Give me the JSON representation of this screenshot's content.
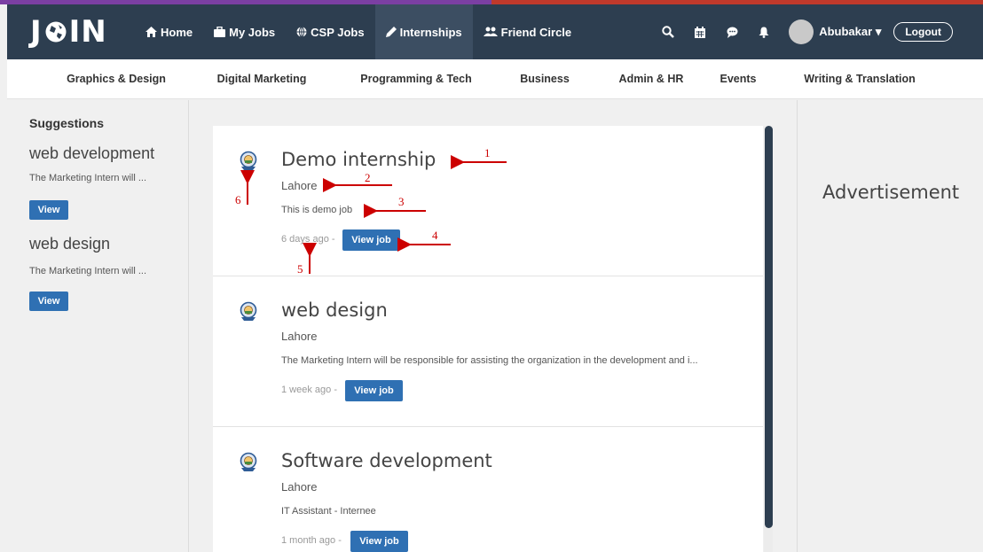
{
  "topnav": {
    "logo": {
      "j": "J",
      "in": "IN"
    },
    "links": [
      {
        "label": "Home",
        "icon": "home-icon"
      },
      {
        "label": "My Jobs",
        "icon": "briefcase-icon"
      },
      {
        "label": "CSP Jobs",
        "icon": "globe-icon"
      },
      {
        "label": "Internships",
        "icon": "pencil-icon",
        "active": true
      },
      {
        "label": "Friend Circle",
        "icon": "users-icon"
      }
    ],
    "right_icons": [
      "search-icon",
      "calendar-icon",
      "chat-icon",
      "bell-icon"
    ],
    "user_name": "Abubakar",
    "logout_label": "Logout"
  },
  "categories": [
    "Graphics & Design",
    "Digital Marketing",
    "Programming & Tech",
    "Business",
    "Admin & HR",
    "Events",
    "Writing & Translation"
  ],
  "sidebar": {
    "heading": "Suggestions",
    "items": [
      {
        "title": "web development",
        "desc": "The Marketing Intern will ...",
        "button": "View"
      },
      {
        "title": "web design",
        "desc": "The Marketing Intern will ...",
        "button": "View"
      }
    ]
  },
  "jobs": [
    {
      "title": "Demo internship",
      "location": "Lahore",
      "description": "This is demo job",
      "time": "6 days ago -",
      "button": "View job"
    },
    {
      "title": "web design",
      "location": "Lahore",
      "description": "The Marketing Intern will be responsible for assisting the organization in the development and i...",
      "time": "1 week ago -",
      "button": "View job"
    },
    {
      "title": "Software development",
      "location": "Lahore",
      "description": "IT Assistant - Internee",
      "time": "1 month ago -",
      "button": "View job"
    }
  ],
  "right_panel": {
    "advertisement": "Advertisement"
  },
  "annotations": [
    "1",
    "2",
    "3",
    "4",
    "5",
    "6"
  ],
  "colors": {
    "nav_bg": "#2d3e50",
    "button_blue": "#2f70b3",
    "annotation_red": "#cc0000"
  }
}
